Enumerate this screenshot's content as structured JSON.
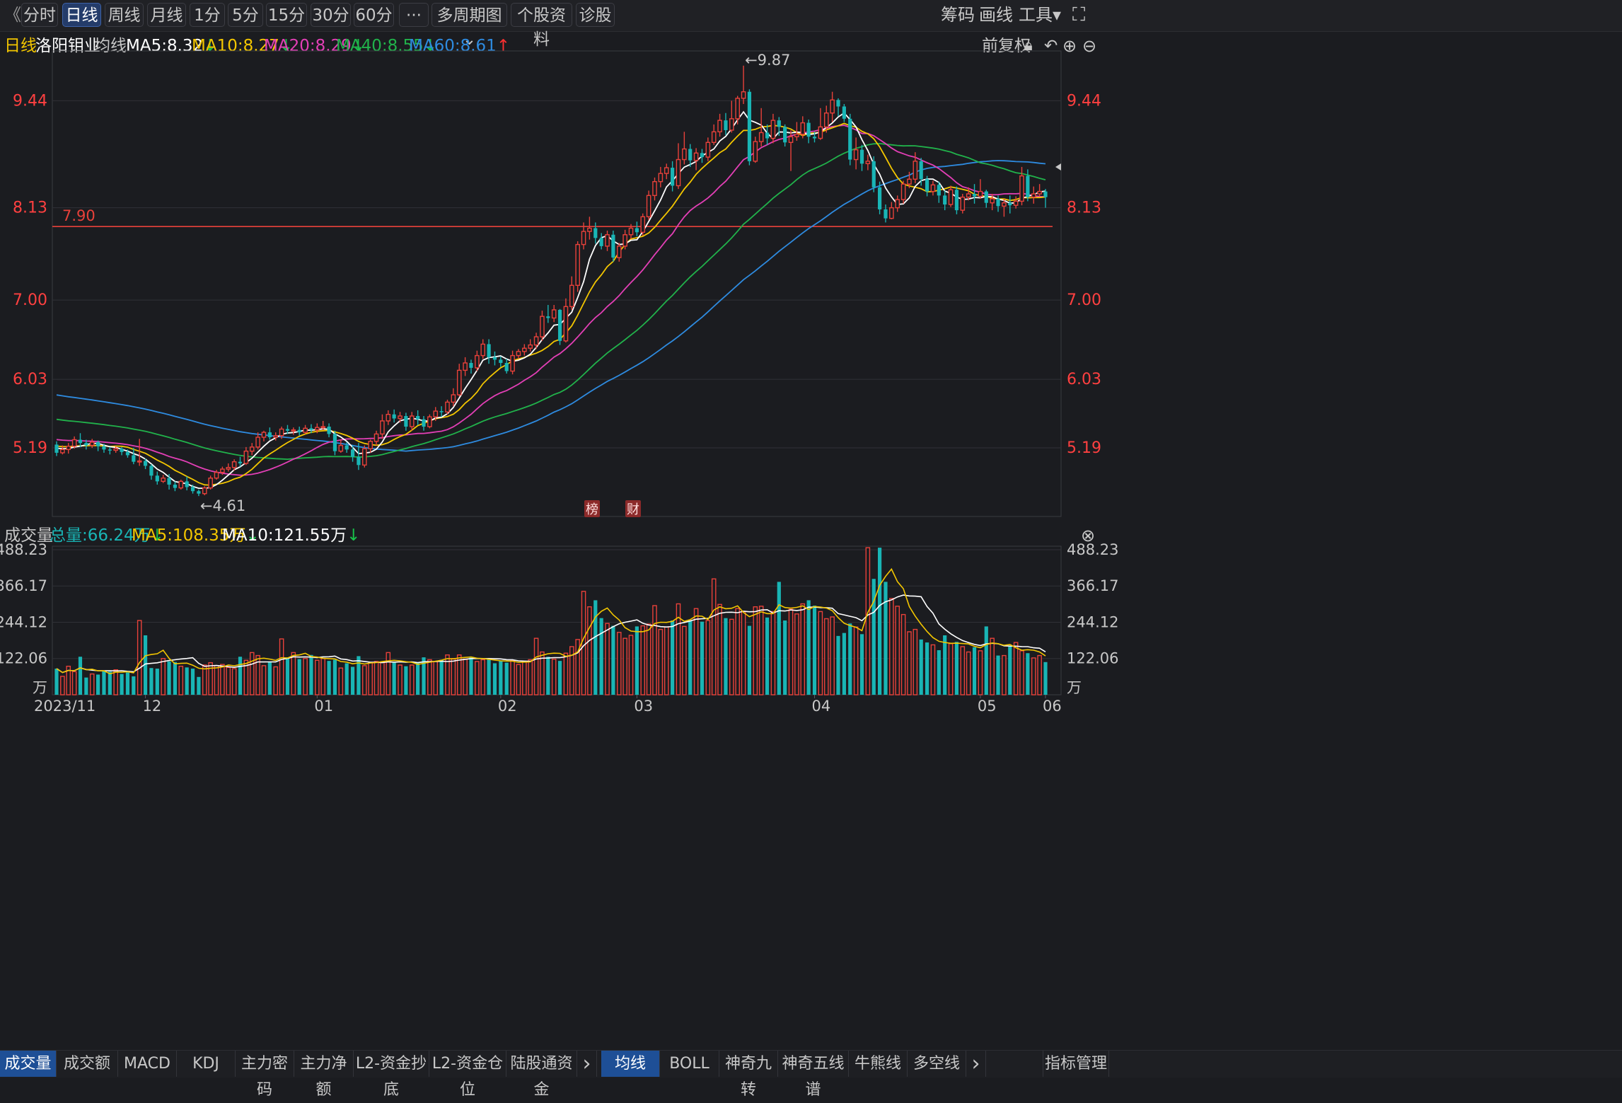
{
  "toolbar": {
    "back_glyph": "《",
    "buttons": [
      "分时",
      "日线",
      "周线",
      "月线",
      "1分",
      "5分",
      "15分",
      "30分",
      "60分",
      "···",
      "多周期图 ⌄",
      "个股资料",
      "诊股"
    ],
    "active_index": 1,
    "right_items": [
      "筹码",
      "画线",
      "工具▾"
    ],
    "fullscreen_icon": "⛶"
  },
  "info": {
    "period": "日线",
    "name": "洛阳钼业",
    "ma_label": "均线",
    "ma": [
      {
        "text": "MA5:8.32",
        "arrow": "↓",
        "color": "#ffffff",
        "arrow_color": "#18c24a"
      },
      {
        "text": "MA10:8.27",
        "arrow": "↓",
        "color": "#f3c600",
        "arrow_color": "#18c24a"
      },
      {
        "text": "MA20:8.29",
        "arrow": "↓",
        "color": "#e33fb6",
        "arrow_color": "#18c24a"
      },
      {
        "text": "MA40:8.55",
        "arrow": "↓",
        "color": "#21b24b",
        "arrow_color": "#18c24a"
      },
      {
        "text": "MA60:8.61",
        "arrow": "↑",
        "color": "#2e8be0",
        "arrow_color": "#ff3030"
      }
    ],
    "adjust": "前复权",
    "icons": [
      "lock-icon",
      "undo-icon",
      "zoom-in-icon",
      "zoom-out-icon"
    ]
  },
  "volume_info": {
    "label": "成交量",
    "total": "总量:66.24万",
    "total_arrow": "↓",
    "ma5": "MA5:108.35万",
    "ma5_arrow": "↓",
    "ma10": "MA10:121.55万",
    "ma10_arrow": "↓",
    "close_icon": "⊗"
  },
  "price_axis": {
    "ticks": [
      "9.44",
      "8.13",
      "7.00",
      "6.03",
      "5.19"
    ],
    "values": [
      9.44,
      8.13,
      7.0,
      6.03,
      5.19
    ]
  },
  "volume_axis": {
    "ticks": [
      "488.23",
      "366.17",
      "244.12",
      "122.06"
    ],
    "values": [
      488.23,
      366.17,
      244.12,
      122.06
    ],
    "unit": "万"
  },
  "x_axis": {
    "labels": [
      "2023/11",
      "12",
      "01",
      "02",
      "03",
      "04",
      "05",
      "06"
    ]
  },
  "annotations": {
    "hline": "7.90",
    "high": "←9.87",
    "low": "←4.61",
    "badges": [
      "榜",
      "财"
    ]
  },
  "bottom_tabs": {
    "left": [
      "成交量",
      "成交额",
      "MACD",
      "KDJ",
      "主力密码",
      "主力净额",
      "L2-资金抄底",
      "L2-资金仓位",
      "陆股通资金"
    ],
    "left_active": 0,
    "right": [
      "均线",
      "BOLL",
      "神奇九转",
      "神奇五线谱",
      "牛熊线",
      "多空线"
    ],
    "right_active": 0,
    "more_glyph": "›",
    "manage": "指标管理"
  },
  "colors": {
    "up": "#e8413a",
    "down": "#19b5b5",
    "ma5": "#ffffff",
    "ma10": "#f3c600",
    "ma20": "#e33fb6",
    "ma40": "#21b24b",
    "ma60": "#2e8be0",
    "grid": "#35363c",
    "bg": "#1b1c20"
  },
  "chart_data": {
    "type": "candlestick",
    "title": "洛阳钼业 日线",
    "ylim": [
      4.35,
      10.05
    ],
    "high": 9.87,
    "low": 4.61,
    "hline": 7.9,
    "dates_labels": [
      "2023/11",
      "12",
      "01",
      "02",
      "03",
      "04",
      "05",
      "06"
    ],
    "candles": [
      [
        5.23,
        5.13,
        5.27,
        5.09
      ],
      [
        5.13,
        5.17,
        5.22,
        5.11
      ],
      [
        5.17,
        5.21,
        5.25,
        5.12
      ],
      [
        5.21,
        5.29,
        5.33,
        5.18
      ],
      [
        5.29,
        5.25,
        5.37,
        5.2
      ],
      [
        5.25,
        5.22,
        5.29,
        5.17
      ],
      [
        5.22,
        5.26,
        5.3,
        5.19
      ],
      [
        5.26,
        5.21,
        5.28,
        5.15
      ],
      [
        5.21,
        5.17,
        5.24,
        5.13
      ],
      [
        5.17,
        5.16,
        5.2,
        5.11
      ],
      [
        5.16,
        5.18,
        5.21,
        5.13
      ],
      [
        5.18,
        5.14,
        5.2,
        5.1
      ],
      [
        5.14,
        5.1,
        5.17,
        5.07
      ],
      [
        5.1,
        5.02,
        5.19,
        4.99
      ],
      [
        5.02,
        5.03,
        5.3,
        4.97
      ],
      [
        5.03,
        4.97,
        5.06,
        4.93
      ],
      [
        4.97,
        4.85,
        4.99,
        4.8
      ],
      [
        4.85,
        4.78,
        4.9,
        4.74
      ],
      [
        4.78,
        4.82,
        4.86,
        4.76
      ],
      [
        4.82,
        4.74,
        4.87,
        4.68
      ],
      [
        4.74,
        4.7,
        4.78,
        4.66
      ],
      [
        4.7,
        4.78,
        4.8,
        4.68
      ],
      [
        4.78,
        4.71,
        4.84,
        4.67
      ],
      [
        4.71,
        4.66,
        4.74,
        4.63
      ],
      [
        4.66,
        4.63,
        4.68,
        4.6
      ],
      [
        4.63,
        4.7,
        4.72,
        4.61
      ],
      [
        4.7,
        4.82,
        4.85,
        4.68
      ],
      [
        4.82,
        4.89,
        4.92,
        4.8
      ],
      [
        4.89,
        4.93,
        4.96,
        4.86
      ],
      [
        4.93,
        4.95,
        5.0,
        4.9
      ],
      [
        4.95,
        5.02,
        5.05,
        4.91
      ],
      [
        5.02,
        5.0,
        5.08,
        4.96
      ],
      [
        5.0,
        5.15,
        5.2,
        4.98
      ],
      [
        5.15,
        5.2,
        5.25,
        5.1
      ],
      [
        5.2,
        5.32,
        5.38,
        5.17
      ],
      [
        5.32,
        5.38,
        5.4,
        5.27
      ],
      [
        5.38,
        5.32,
        5.44,
        5.29
      ],
      [
        5.32,
        5.34,
        5.38,
        5.28
      ],
      [
        5.34,
        5.42,
        5.45,
        5.3
      ],
      [
        5.42,
        5.4,
        5.47,
        5.36
      ],
      [
        5.4,
        5.41,
        5.44,
        5.35
      ],
      [
        5.41,
        5.38,
        5.45,
        5.34
      ],
      [
        5.38,
        5.43,
        5.47,
        5.36
      ],
      [
        5.43,
        5.41,
        5.48,
        5.37
      ],
      [
        5.41,
        5.44,
        5.49,
        5.37
      ],
      [
        5.44,
        5.45,
        5.52,
        5.41
      ],
      [
        5.45,
        5.36,
        5.49,
        5.32
      ],
      [
        5.36,
        5.15,
        5.4,
        5.1
      ],
      [
        5.15,
        5.22,
        5.29,
        5.13
      ],
      [
        5.22,
        5.17,
        5.26,
        5.13
      ],
      [
        5.17,
        5.08,
        5.22,
        5.02
      ],
      [
        5.08,
        4.98,
        5.25,
        4.92
      ],
      [
        4.98,
        5.18,
        5.22,
        4.95
      ],
      [
        5.18,
        5.27,
        5.29,
        5.13
      ],
      [
        5.27,
        5.36,
        5.4,
        5.22
      ],
      [
        5.36,
        5.52,
        5.6,
        5.3
      ],
      [
        5.52,
        5.6,
        5.65,
        5.47
      ],
      [
        5.6,
        5.55,
        5.66,
        5.5
      ],
      [
        5.55,
        5.58,
        5.63,
        5.5
      ],
      [
        5.58,
        5.45,
        5.62,
        5.4
      ],
      [
        5.45,
        5.58,
        5.63,
        5.4
      ],
      [
        5.58,
        5.54,
        5.65,
        5.47
      ],
      [
        5.54,
        5.45,
        5.58,
        5.4
      ],
      [
        5.45,
        5.57,
        5.6,
        5.43
      ],
      [
        5.57,
        5.64,
        5.69,
        5.52
      ],
      [
        5.64,
        5.63,
        5.7,
        5.57
      ],
      [
        5.63,
        5.75,
        5.78,
        5.6
      ],
      [
        5.75,
        5.84,
        5.92,
        5.7
      ],
      [
        5.84,
        6.14,
        6.22,
        5.82
      ],
      [
        6.14,
        6.23,
        6.3,
        6.07
      ],
      [
        6.23,
        6.17,
        6.27,
        6.1
      ],
      [
        6.17,
        6.32,
        6.38,
        6.13
      ],
      [
        6.32,
        6.46,
        6.52,
        6.28
      ],
      [
        6.46,
        6.3,
        6.52,
        6.22
      ],
      [
        6.3,
        6.27,
        6.37,
        6.2
      ],
      [
        6.27,
        6.23,
        6.31,
        6.18
      ],
      [
        6.23,
        6.13,
        6.28,
        6.1
      ],
      [
        6.13,
        6.32,
        6.38,
        6.09
      ],
      [
        6.32,
        6.37,
        6.4,
        6.28
      ],
      [
        6.37,
        6.41,
        6.46,
        6.32
      ],
      [
        6.41,
        6.45,
        6.52,
        6.37
      ],
      [
        6.45,
        6.55,
        6.6,
        6.4
      ],
      [
        6.55,
        6.8,
        6.87,
        6.5
      ],
      [
        6.8,
        6.78,
        6.94,
        6.72
      ],
      [
        6.78,
        6.88,
        6.94,
        6.73
      ],
      [
        6.88,
        6.5,
        6.89,
        6.45
      ],
      [
        6.5,
        6.92,
        7.02,
        6.48
      ],
      [
        6.92,
        7.18,
        7.29,
        6.88
      ],
      [
        7.18,
        7.68,
        7.72,
        7.1
      ],
      [
        7.68,
        7.84,
        7.95,
        7.62
      ],
      [
        7.84,
        7.88,
        8.02,
        7.74
      ],
      [
        7.88,
        7.76,
        7.95,
        7.69
      ],
      [
        7.76,
        7.66,
        7.82,
        7.62
      ],
      [
        7.66,
        7.8,
        7.85,
        7.6
      ],
      [
        7.8,
        7.52,
        7.85,
        7.47
      ],
      [
        7.52,
        7.66,
        7.7,
        7.47
      ],
      [
        7.66,
        7.8,
        7.86,
        7.62
      ],
      [
        7.8,
        7.88,
        7.93,
        7.75
      ],
      [
        7.88,
        7.83,
        7.96,
        7.78
      ],
      [
        7.83,
        8.02,
        8.06,
        7.79
      ],
      [
        8.02,
        8.28,
        8.34,
        7.98
      ],
      [
        8.28,
        8.45,
        8.5,
        8.22
      ],
      [
        8.45,
        8.55,
        8.63,
        8.38
      ],
      [
        8.55,
        8.62,
        8.67,
        8.48
      ],
      [
        8.62,
        8.4,
        8.7,
        8.33
      ],
      [
        8.4,
        8.72,
        8.92,
        8.36
      ],
      [
        8.72,
        8.85,
        9.06,
        8.66
      ],
      [
        8.85,
        8.71,
        8.91,
        8.63
      ],
      [
        8.71,
        8.8,
        8.86,
        8.59
      ],
      [
        8.8,
        8.75,
        8.85,
        8.68
      ],
      [
        8.75,
        8.93,
        8.99,
        8.7
      ],
      [
        8.93,
        9.06,
        9.15,
        8.9
      ],
      [
        9.06,
        9.2,
        9.28,
        9.0
      ],
      [
        9.2,
        9.08,
        9.29,
        9.02
      ],
      [
        9.08,
        9.22,
        9.44,
        9.05
      ],
      [
        9.22,
        9.47,
        9.5,
        9.15
      ],
      [
        9.47,
        9.55,
        9.87,
        9.4
      ],
      [
        9.55,
        8.7,
        9.58,
        8.65
      ],
      [
        8.7,
        8.94,
        9.0,
        8.68
      ],
      [
        8.94,
        9.05,
        9.35,
        8.88
      ],
      [
        9.05,
        8.98,
        9.15,
        8.9
      ],
      [
        8.98,
        9.2,
        9.28,
        8.92
      ],
      [
        9.2,
        9.12,
        9.24,
        9.01
      ],
      [
        9.12,
        8.93,
        9.15,
        8.88
      ],
      [
        8.93,
        9.0,
        9.08,
        8.58
      ],
      [
        9.0,
        9.03,
        9.18,
        8.95
      ],
      [
        9.03,
        9.17,
        9.25,
        8.98
      ],
      [
        9.17,
        9.0,
        9.21,
        8.92
      ],
      [
        9.0,
        8.98,
        9.06,
        8.93
      ],
      [
        8.98,
        9.12,
        9.35,
        8.96
      ],
      [
        9.12,
        9.29,
        9.38,
        9.05
      ],
      [
        9.29,
        9.45,
        9.55,
        9.18
      ],
      [
        9.45,
        9.37,
        9.47,
        9.25
      ],
      [
        9.37,
        9.22,
        9.4,
        9.18
      ],
      [
        9.22,
        8.72,
        9.28,
        8.65
      ],
      [
        8.72,
        8.84,
        8.99,
        8.6
      ],
      [
        8.84,
        8.67,
        8.9,
        8.58
      ],
      [
        8.67,
        8.7,
        8.78,
        8.59
      ],
      [
        8.7,
        8.38,
        8.76,
        8.32
      ],
      [
        8.38,
        8.11,
        8.45,
        8.05
      ],
      [
        8.11,
        8.0,
        8.17,
        7.95
      ],
      [
        8.0,
        8.13,
        8.2,
        7.99
      ],
      [
        8.13,
        8.23,
        8.28,
        8.08
      ],
      [
        8.23,
        8.42,
        8.46,
        8.18
      ],
      [
        8.42,
        8.48,
        8.57,
        8.37
      ],
      [
        8.48,
        8.7,
        8.81,
        8.43
      ],
      [
        8.7,
        8.48,
        8.74,
        8.4
      ],
      [
        8.48,
        8.33,
        8.52,
        8.27
      ],
      [
        8.33,
        8.41,
        8.46,
        8.28
      ],
      [
        8.41,
        8.28,
        8.45,
        8.19
      ],
      [
        8.28,
        8.17,
        8.34,
        8.1
      ],
      [
        8.17,
        8.35,
        8.4,
        8.14
      ],
      [
        8.35,
        8.1,
        8.39,
        8.05
      ],
      [
        8.1,
        8.26,
        8.3,
        8.06
      ],
      [
        8.26,
        8.3,
        8.38,
        8.22
      ],
      [
        8.3,
        8.27,
        8.42,
        8.18
      ],
      [
        8.27,
        8.33,
        8.48,
        8.24
      ],
      [
        8.33,
        8.19,
        8.35,
        8.13
      ],
      [
        8.19,
        8.24,
        8.3,
        8.1
      ],
      [
        8.24,
        8.15,
        8.28,
        8.08
      ],
      [
        8.15,
        8.19,
        8.24,
        8.02
      ],
      [
        8.19,
        8.16,
        8.28,
        8.06
      ],
      [
        8.16,
        8.21,
        8.27,
        8.12
      ],
      [
        8.21,
        8.52,
        8.63,
        8.16
      ],
      [
        8.52,
        8.26,
        8.6,
        8.21
      ],
      [
        8.26,
        8.3,
        8.39,
        8.18
      ],
      [
        8.3,
        8.33,
        8.42,
        8.27
      ],
      [
        8.33,
        8.26,
        8.36,
        8.13
      ]
    ],
    "volume": [
      88,
      62,
      96,
      78,
      128,
      58,
      70,
      68,
      80,
      78,
      84,
      70,
      75,
      62,
      250,
      200,
      90,
      88,
      122,
      112,
      110,
      96,
      92,
      88,
      60,
      100,
      108,
      98,
      102,
      92,
      88,
      128,
      116,
      142,
      132,
      98,
      112,
      94,
      188,
      126,
      142,
      120,
      122,
      134,
      116,
      122,
      114,
      118,
      90,
      106,
      94,
      130,
      98,
      108,
      112,
      110,
      142,
      108,
      100,
      96,
      100,
      108,
      126,
      118,
      112,
      118,
      134,
      122,
      134,
      120,
      126,
      112,
      118,
      122,
      106,
      114,
      108,
      116,
      102,
      110,
      118,
      190,
      144,
      128,
      120,
      114,
      140,
      162,
      186,
      348,
      296,
      318,
      258,
      240,
      232,
      210,
      190,
      200,
      230,
      232,
      238,
      300,
      220,
      228,
      250,
      306,
      230,
      250,
      290,
      246,
      250,
      390,
      304,
      258,
      254,
      290,
      280,
      232,
      296,
      298,
      260,
      280,
      380,
      250,
      288,
      272,
      306,
      318,
      300,
      280,
      256,
      262,
      198,
      208,
      240,
      228,
      204,
      508,
      390,
      512,
      380,
      324,
      298,
      270,
      212,
      220,
      186,
      176,
      168,
      150,
      200,
      172,
      178,
      162,
      144,
      160,
      148,
      230,
      190,
      132,
      132,
      162,
      176,
      148,
      140,
      124,
      132,
      110,
      92,
      100,
      152,
      140,
      124,
      102,
      118,
      118,
      108,
      112,
      110,
      96
    ]
  }
}
